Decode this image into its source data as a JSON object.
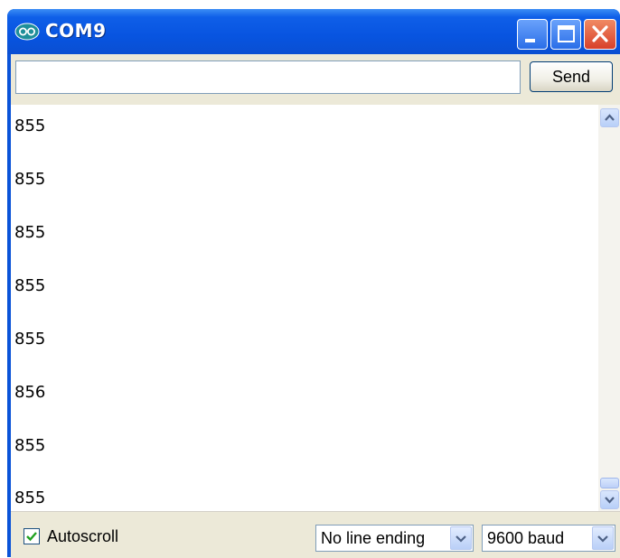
{
  "window": {
    "title": "COM9",
    "controls": [
      "minimize",
      "maximize",
      "close"
    ]
  },
  "toolbar": {
    "input_value": "",
    "send_label": "Send"
  },
  "output": {
    "lines": [
      "855",
      "855",
      "855",
      "855",
      "855",
      "856",
      "855",
      "855"
    ]
  },
  "statusbar": {
    "autoscroll_label": "Autoscroll",
    "autoscroll_checked": true,
    "line_ending": "No line ending",
    "baud_rate": "9600 baud"
  },
  "icons": {
    "app": "arduino-infinity-icon",
    "minimize": "minimize-icon",
    "maximize": "maximize-icon",
    "close": "close-icon",
    "scroll_up": "chevron-up-icon",
    "scroll_down": "chevron-down-icon",
    "dropdown": "chevron-down-icon",
    "check": "checkmark-icon"
  },
  "colors": {
    "titlebar": "#0a53d8",
    "close_button": "#d8402a",
    "client_bg": "#ece9d8",
    "check_green": "#21a121"
  }
}
